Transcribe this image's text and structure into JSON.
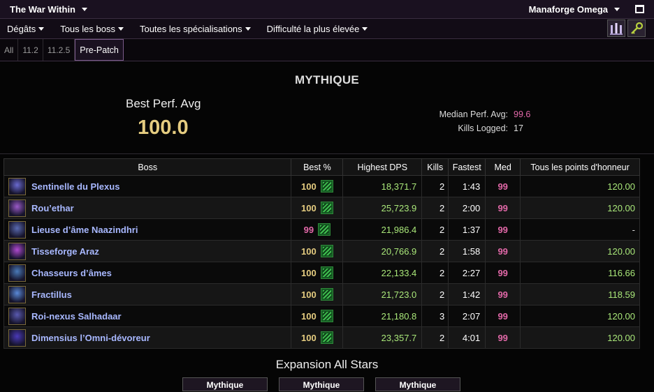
{
  "topbar": {
    "expansion": "The War Within",
    "server": "Manaforge Omega"
  },
  "filters": [
    "Dégâts",
    "Tous les boss",
    "Toutes les spécialisations",
    "Difficulté la plus élevée"
  ],
  "tabs": [
    "All",
    "11.2",
    "11.2.5",
    "Pre-Patch"
  ],
  "active_tab": "Pre-Patch",
  "summary": {
    "difficulty": "MYTHIQUE",
    "best_perf_label": "Best Perf. Avg",
    "best_perf_value": "100.0",
    "median_label": "Median Perf. Avg:",
    "median_value": "99.6",
    "kills_label": "Kills Logged:",
    "kills_value": "17"
  },
  "columns": [
    "Boss",
    "Best %",
    "Highest DPS",
    "Kills",
    "Fastest",
    "Med",
    "Tous les points d'honneur"
  ],
  "bosses": [
    {
      "name": "Sentinelle du Plexus",
      "best": "100",
      "dps": "18,371.7",
      "kills": "2",
      "fastest": "1:43",
      "med": "99",
      "points": "120.00",
      "icon": "#6a6ad0"
    },
    {
      "name": "Rou’ethar",
      "best": "100",
      "dps": "25,723.9",
      "kills": "2",
      "fastest": "2:00",
      "med": "99",
      "points": "120.00",
      "icon": "#9a5ac8"
    },
    {
      "name": "Lieuse d’âme Naazindhri",
      "best": "99",
      "dps": "21,986.4",
      "kills": "2",
      "fastest": "1:37",
      "med": "99",
      "points": "-",
      "icon": "#5a6ab0"
    },
    {
      "name": "Tisseforge Araz",
      "best": "100",
      "dps": "20,766.9",
      "kills": "2",
      "fastest": "1:58",
      "med": "99",
      "points": "120.00",
      "icon": "#b04ad0"
    },
    {
      "name": "Chasseurs d’âmes",
      "best": "100",
      "dps": "22,133.4",
      "kills": "2",
      "fastest": "2:27",
      "med": "99",
      "points": "116.66",
      "icon": "#4a7ab8"
    },
    {
      "name": "Fractillus",
      "best": "100",
      "dps": "21,723.0",
      "kills": "2",
      "fastest": "1:42",
      "med": "99",
      "points": "118.59",
      "icon": "#5a8ad8"
    },
    {
      "name": "Roi-nexus Salhadaar",
      "best": "100",
      "dps": "21,180.8",
      "kills": "3",
      "fastest": "2:07",
      "med": "99",
      "points": "120.00",
      "icon": "#5a5ab0"
    },
    {
      "name": "Dimensius l’Omni-dévoreur",
      "best": "100",
      "dps": "23,357.7",
      "kills": "2",
      "fastest": "4:01",
      "med": "99",
      "points": "120.00",
      "icon": "#4a3ab8"
    }
  ],
  "allstars_title": "Expansion All Stars",
  "allstars_tabs": [
    "Mythique",
    "Mythique",
    "Mythique"
  ],
  "colors": {
    "orange": "#e5cc80",
    "pink": "#e268a8",
    "green": "#a9e779",
    "boss_name": "#a8b8ff"
  }
}
